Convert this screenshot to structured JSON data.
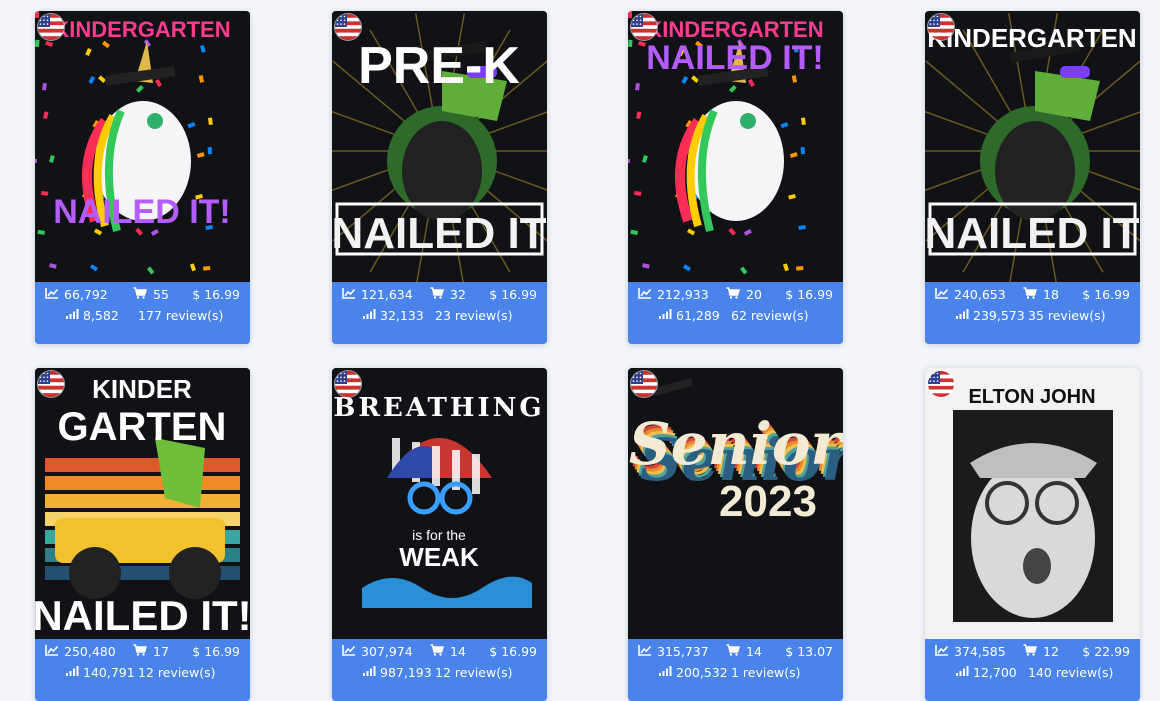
{
  "cards": [
    {
      "flag": "us-flag-icon",
      "views": "66,792",
      "sales": "55",
      "price": "$ 16.99",
      "bsr": "8,582",
      "reviews": "177 review(s)",
      "art": {
        "kind": "unicorn",
        "title_top": "KINDERGARTEN",
        "title_bottom": "NAILED IT!"
      }
    },
    {
      "flag": "us-flag-icon",
      "views": "121,634",
      "sales": "32",
      "price": "$ 16.99",
      "bsr": "32,133",
      "reviews": "23 review(s)",
      "art": {
        "kind": "trex",
        "title_top": "PRE-K",
        "title_bottom": "NAILED IT"
      }
    },
    {
      "flag": "us-flag-icon",
      "views": "212,933",
      "sales": "20",
      "price": "$ 16.99",
      "bsr": "61,289",
      "reviews": "62 review(s)",
      "art": {
        "kind": "unicorn2",
        "title_top": "KINDERGARTEN",
        "title_bottom": "NAILED IT!"
      }
    },
    {
      "flag": "us-flag-icon",
      "views": "240,653",
      "sales": "18",
      "price": "$ 16.99",
      "bsr": "239,573",
      "reviews": "35 review(s)",
      "art": {
        "kind": "trex",
        "title_top": "KINDERGARTEN",
        "title_bottom": "NAILED IT"
      }
    },
    {
      "flag": "us-flag-icon",
      "views": "250,480",
      "sales": "17",
      "price": "$ 16.99",
      "bsr": "140,791",
      "reviews": "12 review(s)",
      "art": {
        "kind": "monster",
        "title_top": "KINDER",
        "title_mid": "GARTEN",
        "title_bottom": "NAILED IT!"
      }
    },
    {
      "flag": "us-flag-icon",
      "views": "307,974",
      "sales": "14",
      "price": "$ 16.99",
      "bsr": "987,193",
      "reviews": "12 review(s)",
      "art": {
        "kind": "swim",
        "title_top": "BREATHING",
        "title_mid": "is for the",
        "title_bottom": "WEAK"
      }
    },
    {
      "flag": "us-flag-icon",
      "views": "315,737",
      "sales": "14",
      "price": "$ 13.07",
      "bsr": "200,532",
      "reviews": "1 review(s)",
      "art": {
        "kind": "senior",
        "title_top": "Senior",
        "title_bottom": "2023"
      }
    },
    {
      "flag": "us-flag-icon",
      "views": "374,585",
      "sales": "12",
      "price": "$ 22.99",
      "bsr": "12,700",
      "reviews": "140 review(s)",
      "art": {
        "kind": "elton",
        "title_top": "ELTON JOHN"
      }
    }
  ],
  "colors": {
    "accent": "#4a84ea",
    "shirt": "#101216",
    "page_bg": "#f3f5f9"
  }
}
